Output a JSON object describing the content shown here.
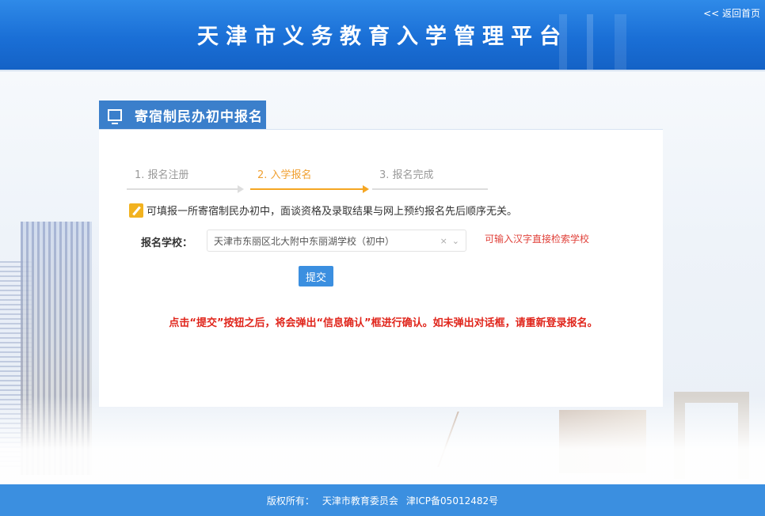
{
  "header": {
    "title": "天津市义务教育入学管理平台",
    "home_link": "<< 返回首页"
  },
  "panel": {
    "tab_title": "寄宿制民办初中报名",
    "steps": [
      {
        "label": "1. 报名注册",
        "state": "done"
      },
      {
        "label": "2. 入学报名",
        "state": "active"
      },
      {
        "label": "3. 报名完成",
        "state": "pending"
      }
    ],
    "notice": "可填报一所寄宿制民办初中，面谈资格及录取结果与网上预约报名先后顺序无关。",
    "form": {
      "school_label": "报名学校：",
      "school_value": "天津市东丽区北大附中东丽湖学校（初中）",
      "clear_symbol": "×",
      "dropdown_symbol": "⌄",
      "hint": "可输入汉字直接检索学校",
      "submit_label": "提交"
    },
    "warning": "点击“提交”按钮之后，将会弹出“信息确认”框进行确认。如未弹出对话框，请重新登录报名。"
  },
  "footer": {
    "copyright_label": "版权所有：",
    "owner": "天津市教育委员会",
    "icp": "津ICP备05012482号"
  },
  "colors": {
    "header_blue": "#1a6fd6",
    "tab_blue": "#3b7fcb",
    "button_blue": "#3b8fe0",
    "active_step": "#f5a623",
    "warning_red": "#e0251b"
  }
}
